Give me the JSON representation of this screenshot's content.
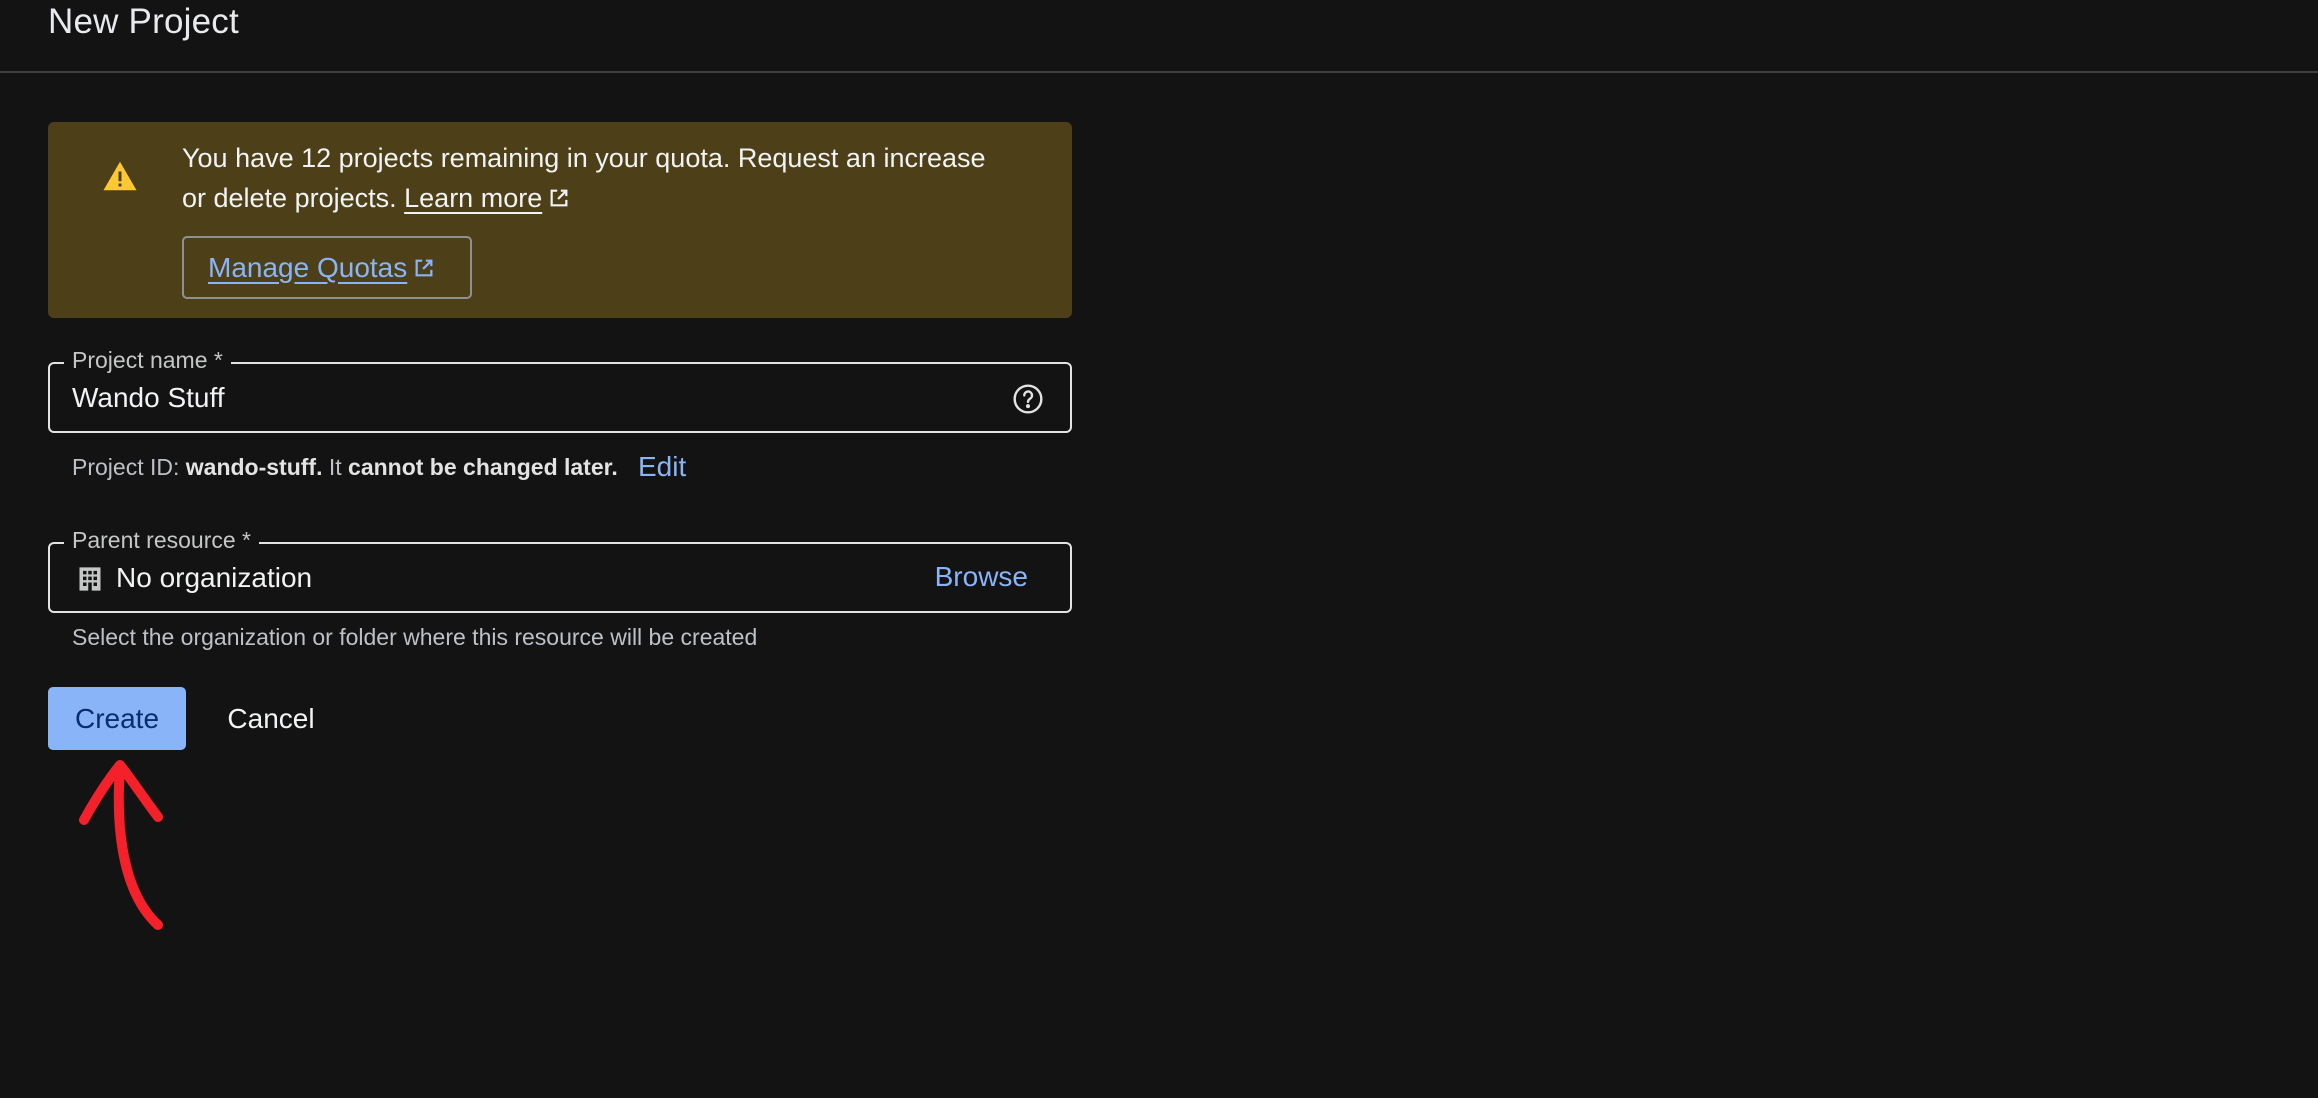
{
  "header": {
    "title": "New Project"
  },
  "quota_banner": {
    "icon": "warning-icon",
    "message_line1": "You have 12 projects remaining in your quota. Request an increase",
    "message_line2": "or delete projects.",
    "learn_more_label": "Learn more",
    "manage_quotas_label": "Manage Quotas",
    "background_color": "#4d4019",
    "icon_color": "#fcc934"
  },
  "project_name": {
    "label": "Project name *",
    "value": "Wando Stuff",
    "help_icon": "help-circle-icon",
    "hint_prefix": "Project ID:",
    "project_id": "wando-stuff.",
    "hint_middle": "It",
    "hint_bold": "cannot be changed later.",
    "edit_label": "Edit"
  },
  "parent_resource": {
    "label": "Parent resource *",
    "icon": "organization-icon",
    "value": "No organization",
    "browse_label": "Browse",
    "hint": "Select the organization or folder where this resource will be created"
  },
  "actions": {
    "create_label": "Create",
    "cancel_label": "Cancel",
    "primary_color": "#8ab4f8"
  },
  "annotation": {
    "arrow_color": "#f4212b"
  }
}
